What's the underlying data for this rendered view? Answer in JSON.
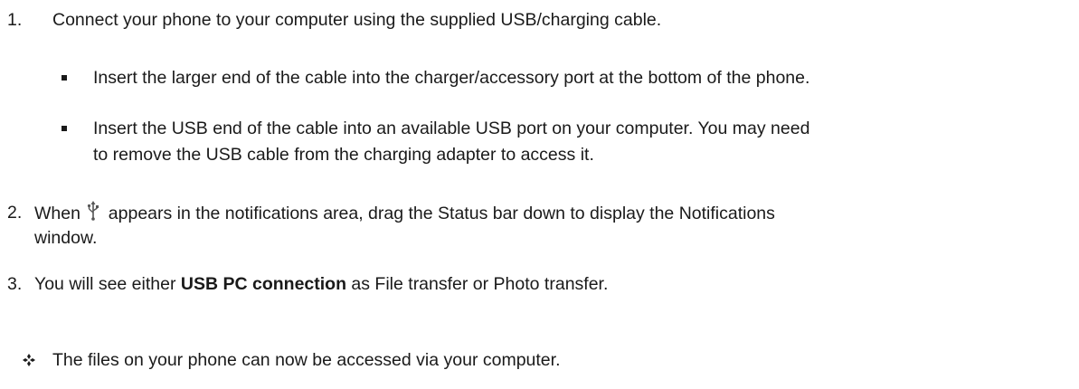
{
  "steps": [
    {
      "number": "1.",
      "text": "Connect your phone to your computer using the supplied USB/charging cable.",
      "subitems": [
        "Insert the larger end of the cable into the charger/accessory port at the bottom of the phone.",
        "Insert the USB end of the cable into an available USB port on your computer. You may need",
        "to remove the USB cable from the charging adapter to access it."
      ]
    },
    {
      "number": "2.",
      "text_before_icon": "When",
      "text_after_icon": "appears in the notifications area, drag the Status bar down to display the Notifications",
      "text_line2": "window.",
      "icon": "usb-icon"
    },
    {
      "number": "3.",
      "text_before_bold": "You will see either",
      "bold": "USB PC connection",
      "text_after_bold": "as File transfer or Photo transfer."
    }
  ],
  "note": {
    "icon": "four-diamond-bullet-icon",
    "text": "The files on your phone can now be accessed via your computer."
  }
}
